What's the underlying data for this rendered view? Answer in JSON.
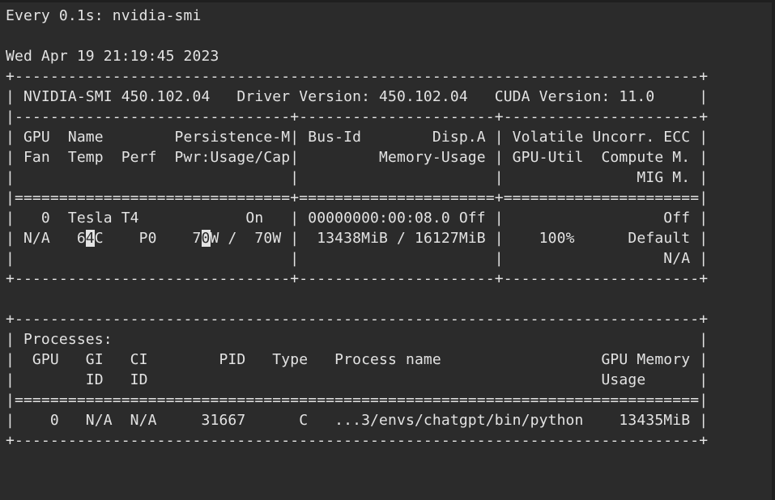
{
  "watch_header": "Every 0.1s: nvidia-smi",
  "timestamp": "Wed Apr 19 21:19:45 2023",
  "gpu_table": {
    "border_top": "+-----------------------------------------------------------------------------+",
    "version_line": "| NVIDIA-SMI 450.102.04   Driver Version: 450.102.04   CUDA Version: 11.0     |",
    "divider": "|-------------------------------+----------------------+----------------------+",
    "header_line_1": "| GPU  Name        Persistence-M| Bus-Id        Disp.A | Volatile Uncorr. ECC |",
    "header_line_2": "| Fan  Temp  Perf  Pwr:Usage/Cap|         Memory-Usage | GPU-Util  Compute M. |",
    "header_line_3": "|                               |                      |               MIG M. |",
    "double_divider": "|===============================+======================+======================|",
    "row_line_1": "|   0  Tesla T4            On   | 00000000:00:08.0 Off |                  Off |",
    "row_line_2": {
      "prefix": "| N/A   6",
      "temp_cursor_char": "4",
      "middle": "C    P0    7",
      "power_cursor_char": "0",
      "suffix": "W /  70W |  13438MiB / 16127MiB |    100%      Default |"
    },
    "row_line_3": "|                               |                      |                  N/A |",
    "border_bottom": "+-------------------------------+----------------------+----------------------+"
  },
  "process_table": {
    "border_top": "+-----------------------------------------------------------------------------+",
    "title_line": "| Processes:                                                                  |",
    "header_line_1": "|  GPU   GI   CI        PID   Type   Process name                  GPU Memory |",
    "header_line_2": "|        ID   ID                                                   Usage      |",
    "double_divider": "|=============================================================================|",
    "row_line_1": "|    0   N/A  N/A     31667      C   ...3/envs/chatgpt/bin/python    13435MiB |",
    "border_bottom": "+-----------------------------------------------------------------------------+"
  }
}
